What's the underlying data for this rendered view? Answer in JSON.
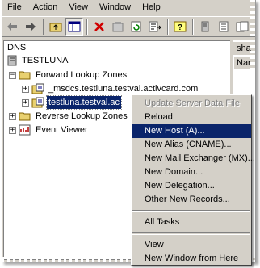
{
  "menubar": {
    "file": "File",
    "action": "Action",
    "view": "View",
    "window": "Window",
    "help": "Help"
  },
  "tree": {
    "root": "DNS",
    "server": "TESTLUNA",
    "forward_zones": "Forward Lookup Zones",
    "zone_msdcs": "_msdcs.testluna.testval.activcard.com",
    "zone_selected": "testluna.testval.ac",
    "reverse_zones": "Reverse Lookup Zones",
    "event_viewer": "Event Viewer"
  },
  "right_pane": {
    "tab": "sha",
    "column_header": "Nar"
  },
  "context_menu": {
    "items": [
      "Update Server Data File",
      "Reload",
      "New Host (A)...",
      "New Alias (CNAME)...",
      "New Mail Exchanger (MX)...",
      "New Domain...",
      "New Delegation...",
      "Other New Records...",
      "All Tasks",
      "View",
      "New Window from Here"
    ],
    "highlighted": "New Host (A)..."
  },
  "colors": {
    "selection": "#0a246a",
    "face": "#d4d0c8"
  }
}
